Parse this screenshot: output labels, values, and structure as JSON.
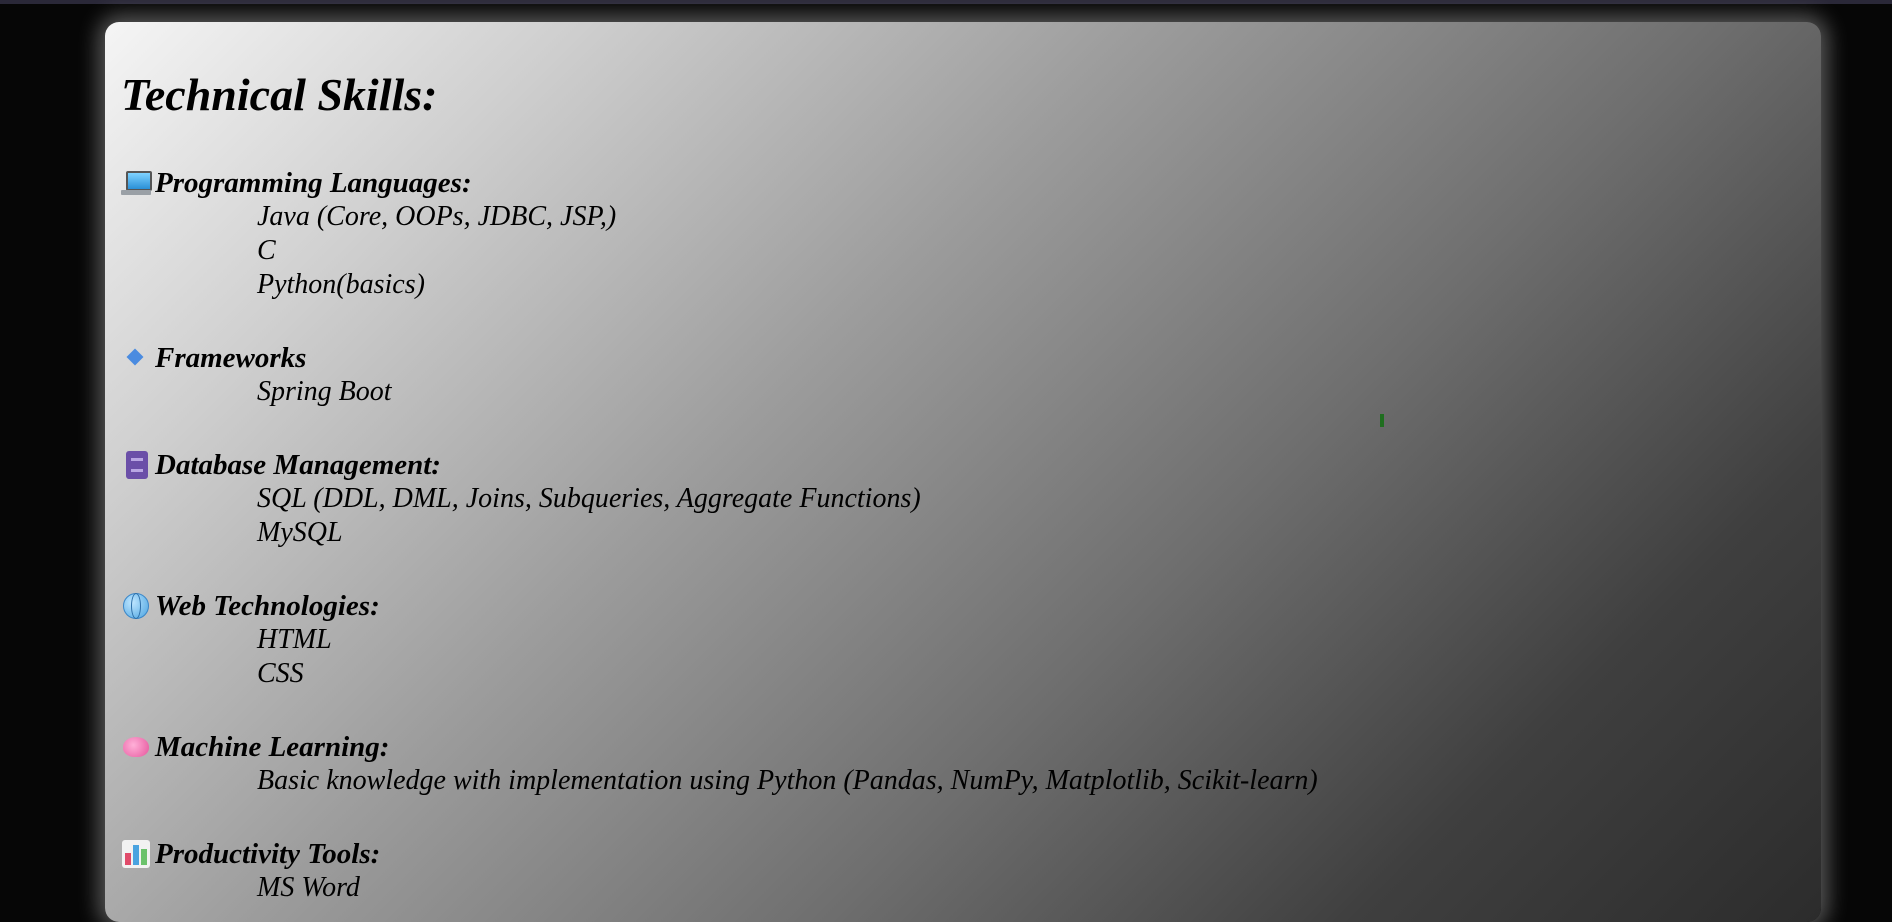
{
  "page": {
    "title": "Technical Skills:"
  },
  "sections": [
    {
      "icon": "laptop-icon",
      "label": "Programming Languages:",
      "items": [
        "Java (Core, OOPs, JDBC, JSP,)",
        "C",
        "Python(basics)"
      ]
    },
    {
      "icon": "diamond-icon",
      "label": "Frameworks",
      "items": [
        "Spring Boot"
      ]
    },
    {
      "icon": "file-cabinet-icon",
      "label": "Database Management:",
      "items": [
        "SQL (DDL, DML, Joins, Subqueries, Aggregate Functions)",
        "MySQL"
      ]
    },
    {
      "icon": "globe-icon",
      "label": "Web Technologies:",
      "items": [
        "HTML",
        "CSS"
      ]
    },
    {
      "icon": "brain-icon",
      "label": "Machine Learning:",
      "items": [
        "Basic knowledge with implementation using Python (Pandas, NumPy, Matplotlib, Scikit-learn)"
      ]
    },
    {
      "icon": "bar-chart-icon",
      "label": "Productivity Tools:",
      "items": [
        "MS Word"
      ]
    }
  ]
}
